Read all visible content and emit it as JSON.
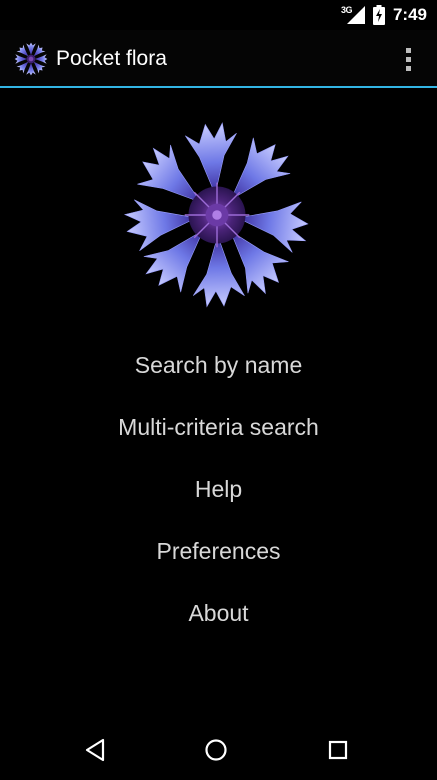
{
  "status_bar": {
    "network_type": "3G",
    "time": "7:49",
    "icons": [
      "signal-icon",
      "battery-charging-icon"
    ]
  },
  "app_bar": {
    "title": "Pocket flora",
    "icon": "cornflower-icon",
    "overflow_icon": "overflow-menu-icon"
  },
  "hero": {
    "image": "cornflower-image"
  },
  "menu": {
    "items": [
      {
        "label": "Search by name"
      },
      {
        "label": "Multi-criteria search"
      },
      {
        "label": "Help"
      },
      {
        "label": "Preferences"
      },
      {
        "label": "About"
      }
    ]
  },
  "nav_bar": {
    "icons": [
      "back-icon",
      "home-icon",
      "recents-icon"
    ]
  },
  "colors": {
    "background": "#000000",
    "accent_line": "#33b5e5",
    "text": "#d8d8d8",
    "flower_petal": "#7b82e8",
    "flower_center": "#5a2a8a"
  }
}
